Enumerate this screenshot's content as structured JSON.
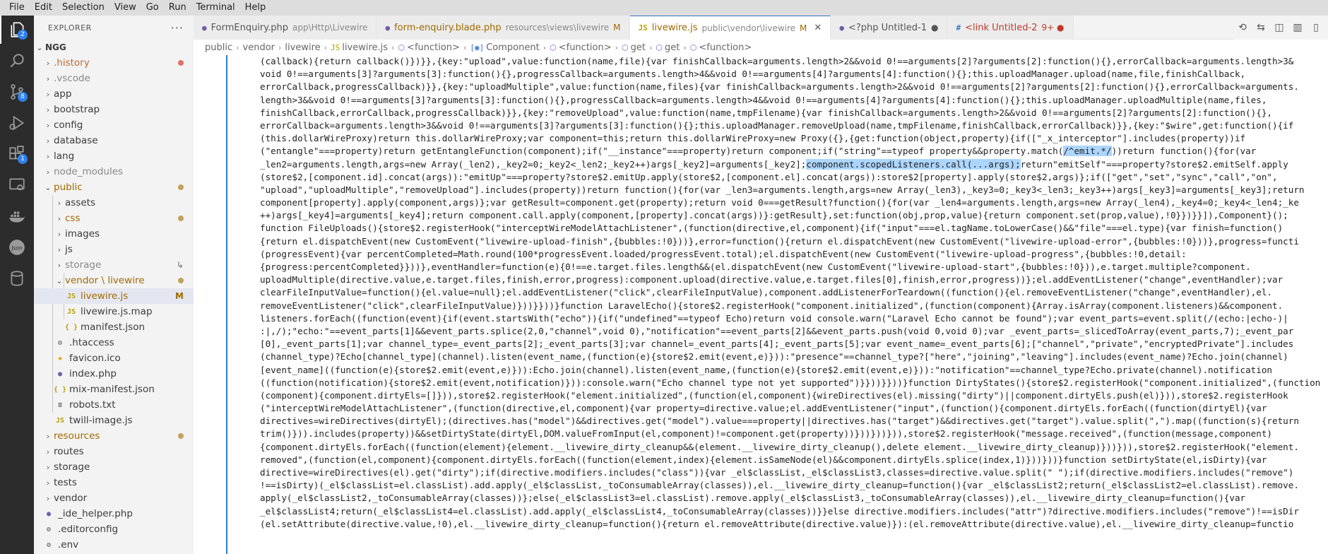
{
  "menu": [
    "File",
    "Edit",
    "Selection",
    "View",
    "Go",
    "Run",
    "Terminal",
    "Help"
  ],
  "activity": {
    "explorer_badge": "2",
    "scm_badge": "8",
    "ext_badge": "1"
  },
  "explorer": {
    "title": "EXPLORER",
    "more": "···",
    "root": "NGG",
    "items": [
      {
        "label": ".history",
        "type": "folder",
        "color": "#c06a30",
        "status": "dot-red"
      },
      {
        "label": ".vscode",
        "type": "folder",
        "color": "#888888",
        "status": ""
      },
      {
        "label": "app",
        "type": "folder",
        "color": "#3a3a3a",
        "status": ""
      },
      {
        "label": "bootstrap",
        "type": "folder",
        "color": "#3a3a3a",
        "status": ""
      },
      {
        "label": "config",
        "type": "folder",
        "color": "#3a3a3a",
        "status": ""
      },
      {
        "label": "database",
        "type": "folder",
        "color": "#3a3a3a",
        "status": ""
      },
      {
        "label": "lang",
        "type": "folder",
        "color": "#3a3a3a",
        "status": ""
      },
      {
        "label": "node_modules",
        "type": "folder",
        "color": "#888888",
        "status": ""
      },
      {
        "label": "public",
        "type": "folder-open",
        "color": "#a06a00",
        "status": "dot-olive"
      },
      {
        "label": "assets",
        "type": "folder",
        "color": "#3a3a3a",
        "status": ""
      },
      {
        "label": "css",
        "type": "folder",
        "color": "#a06a00",
        "status": "dot-olive"
      },
      {
        "label": "images",
        "type": "folder",
        "color": "#3a3a3a",
        "status": ""
      },
      {
        "label": "js",
        "type": "folder",
        "color": "#3a3a3a",
        "status": ""
      },
      {
        "label": "storage",
        "type": "folder",
        "color": "#888888",
        "status": "link"
      },
      {
        "label": "vendor \\ livewire",
        "type": "folder-open",
        "color": "#a06a00",
        "status": "dot-olive"
      },
      {
        "label": "livewire.js",
        "type": "js",
        "color": "#a06a00",
        "status": "M"
      },
      {
        "label": "livewire.js.map",
        "type": "js",
        "color": "#3a3a3a",
        "status": ""
      },
      {
        "label": "manifest.json",
        "type": "json",
        "color": "#3a3a3a",
        "status": ""
      },
      {
        "label": ".htaccess",
        "type": "gear",
        "color": "#3a3a3a",
        "status": ""
      },
      {
        "label": "favicon.ico",
        "type": "star",
        "color": "#3a3a3a",
        "status": ""
      },
      {
        "label": "index.php",
        "type": "php",
        "color": "#3a3a3a",
        "status": ""
      },
      {
        "label": "mix-manifest.json",
        "type": "json",
        "color": "#3a3a3a",
        "status": ""
      },
      {
        "label": "robots.txt",
        "type": "txt",
        "color": "#3a3a3a",
        "status": ""
      },
      {
        "label": "twill-image.js",
        "type": "js",
        "color": "#3a3a3a",
        "status": ""
      },
      {
        "label": "resources",
        "type": "folder",
        "color": "#a06a00",
        "status": "dot-olive"
      },
      {
        "label": "routes",
        "type": "folder",
        "color": "#3a3a3a",
        "status": ""
      },
      {
        "label": "storage",
        "type": "folder",
        "color": "#3a3a3a",
        "status": ""
      },
      {
        "label": "tests",
        "type": "folder",
        "color": "#3a3a3a",
        "status": ""
      },
      {
        "label": "vendor",
        "type": "folder",
        "color": "#3a3a3a",
        "status": ""
      },
      {
        "label": "_ide_helper.php",
        "type": "php",
        "color": "#3a3a3a",
        "status": ""
      },
      {
        "label": ".editorconfig",
        "type": "gear",
        "color": "#3a3a3a",
        "status": ""
      },
      {
        "label": ".env",
        "type": "gear",
        "color": "#3a3a3a",
        "status": ""
      }
    ]
  },
  "tabs": [
    {
      "icon": "php",
      "label": "FormEnquiry.php",
      "desc": "app\\Http\\Livewire",
      "mark": "",
      "active": false,
      "color": "#555555"
    },
    {
      "icon": "php",
      "label": "form-enquiry.blade.php",
      "desc": "resources\\views\\livewire",
      "mark": "M",
      "active": false,
      "color": "#a06a00"
    },
    {
      "icon": "js",
      "label": "livewire.js",
      "desc": "public\\vendor\\livewire",
      "mark": "M",
      "active": true,
      "color": "#a06a00"
    },
    {
      "icon": "php",
      "label": "<?php Untitled-1",
      "desc": "",
      "mark": "●",
      "active": false,
      "color": "#555555"
    },
    {
      "icon": "hash",
      "label": "<link Untitled-2",
      "desc": "",
      "mark": "9+ ●",
      "active": false,
      "color": "#c03a2b"
    }
  ],
  "breadcrumb": [
    "public",
    "vendor",
    "livewire",
    "livewire.js",
    "<function>",
    "Component",
    "<function>",
    "get",
    "get",
    "<function>"
  ],
  "code_lines": [
    "(callback){return callback()})}},{key:\"upload\",value:function(name,file){var finishCallback=arguments.length>2&&void 0!==arguments[2]?arguments[2]:function(){},errorCallback=arguments.length>3&",
    "void 0!==arguments[3]?arguments[3]:function(){},progressCallback=arguments.length>4&&void 0!==arguments[4]?arguments[4]:function(){};this.uploadManager.upload(name,file,finishCallback,",
    "errorCallback,progressCallback)}},{key:\"uploadMultiple\",value:function(name,files){var finishCallback=arguments.length>2&&void 0!==arguments[2]?arguments[2]:function(){},errorCallback=arguments.",
    "length>3&&void 0!==arguments[3]?arguments[3]:function(){},progressCallback=arguments.length>4&&void 0!==arguments[4]?arguments[4]:function(){};this.uploadManager.uploadMultiple(name,files,",
    "finishCallback,errorCallback,progressCallback)}},{key:\"removeUpload\",value:function(name,tmpFilename){var finishCallback=arguments.length>2&&void 0!==arguments[2]?arguments[2]:function(){},",
    "errorCallback=arguments.length>3&&void 0!==arguments[3]?arguments[3]:function(){};this.uploadManager.removeUpload(name,tmpFilename,finishCallback,errorCallback)}},{key:\"$wire\",get:function(){if",
    "(this.dollarWireProxy)return this.dollarWireProxy;var component=this;return this.dollarWireProxy=new Proxy({},{get:function(object,property){if([\"_x_interceptor\"].includes(property))if",
    "(\"entangle\"===property)return getEntangleFunction(component);if(\"__instance\"===property)return component;if(\"string\"==typeof property&&property.match(/^emit.*/))return function(){for(var",
    "_len2=arguments.length,args=new Array(_len2),_key2=0;_key2<_len2;_key2++)args[_key2]=arguments[_key2];component.scopedListeners.call(...args);return\"emitSelf\"===property?store$2.emitSelf.apply",
    "(store$2,[component.id].concat(args)):\"emitUp\"===property?store$2.emitUp.apply(store$2,[component.el].concat(args)):store$2[property].apply(store$2,args)};if([\"get\",\"set\",\"sync\",\"call\",\"on\",",
    "\"upload\",\"uploadMultiple\",\"removeUpload\"].includes(property))return function(){for(var _len3=arguments.length,args=new Array(_len3),_key3=0;_key3<_len3;_key3++)args[_key3]=arguments[_key3];return",
    "component[property].apply(component,args)};var getResult=component.get(property);return void 0===getResult?function(){for(var _len4=arguments.length,args=new Array(_len4),_key4=0;_key4<_len4;_ke",
    "++)args[_key4]=arguments[_key4];return component.call.apply(component,[property].concat(args))}:getResult},set:function(obj,prop,value){return component.set(prop,value),!0}})}}]),Component}();",
    "function FileUploads(){store$2.registerHook(\"interceptWireModelAttachListener\",(function(directive,el,component){if(\"input\"===el.tagName.toLowerCase()&&\"file\"===el.type){var finish=function()",
    "{return el.dispatchEvent(new CustomEvent(\"livewire-upload-finish\",{bubbles:!0}))},error=function(){return el.dispatchEvent(new CustomEvent(\"livewire-upload-error\",{bubbles:!0}))},progress=functi",
    "(progressEvent){var percentCompleted=Math.round(100*progressEvent.loaded/progressEvent.total);el.dispatchEvent(new CustomEvent(\"livewire-upload-progress\",{bubbles:!0,detail:",
    "{progress:percentCompleted}}))},eventHandler=function(e){0!==e.target.files.length&&(el.dispatchEvent(new CustomEvent(\"livewire-upload-start\",{bubbles:!0})),e.target.multiple?component.",
    "uploadMultiple(directive.value,e.target.files,finish,error,progress):component.upload(directive.value,e.target.files[0],finish,error,progress))};el.addEventListener(\"change\",eventHandler);var",
    "clearFileInputValue=function(){el.value=null};el.addEventListener(\"click\",clearFileInputValue),component.addListenerForTeardown((function(){el.removeEventListener(\"change\",eventHandler),el.",
    "removeEventListener(\"click\",clearFileInputValue)}))}}))}function LaravelEcho(){store$2.registerHook(\"component.initialized\",(function(component){Array.isArray(component.listeners)&&component.",
    "listeners.forEach((function(event){if(event.startsWith(\"echo\")){if(\"undefined\"==typeof Echo)return void console.warn(\"Laravel Echo cannot be found\");var event_parts=event.split(/(echo:|echo-)|",
    ":|,/);\"echo:\"==event_parts[1]&&event_parts.splice(2,0,\"channel\",void 0),\"notification\"==event_parts[2]&&event_parts.push(void 0,void 0);var _event_parts=_slicedToArray(event_parts,7);_event_par",
    "[0],_event_parts[1];var channel_type=_event_parts[2];_event_parts[3];var channel=_event_parts[4];_event_parts[5];var event_name=_event_parts[6];[\"channel\",\"private\",\"encryptedPrivate\"].includes",
    "(channel_type)?Echo[channel_type](channel).listen(event_name,(function(e){store$2.emit(event,e)})):\"presence\"==channel_type?[\"here\",\"joining\",\"leaving\"].includes(event_name)?Echo.join(channel)",
    "[event_name]((function(e){store$2.emit(event,e)})):Echo.join(channel).listen(event_name,(function(e){store$2.emit(event,e)})):\"notification\"==channel_type?Echo.private(channel).notification",
    "((function(notification){store$2.emit(event,notification)})):console.warn(\"Echo channel type not yet supported\")}}))}}))}function DirtyStates(){store$2.registerHook(\"component.initialized\",(function",
    "(component){component.dirtyEls=[]})),store$2.registerHook(\"element.initialized\",(function(el,component){wireDirectives(el).missing(\"dirty\")||component.dirtyEls.push(el)})),store$2.registerHook",
    "(\"interceptWireModelAttachListener\",(function(directive,el,component){var property=directive.value;el.addEventListener(\"input\",(function(){component.dirtyEls.forEach((function(dirtyEl){var",
    "directives=wireDirectives(dirtyEl);(directives.has(\"model\")&&directives.get(\"model\").value===property||directives.has(\"target\")&&directives.get(\"target\").value.split(\",\").map((function(s){return",
    "trim()})).includes(property))&&setDirtyState(dirtyEl,DOM.valueFromInput(el,component)!=component.get(property))}))}))})),store$2.registerHook(\"message.received\",(function(message,component)",
    "{component.dirtyEls.forEach((function(element){element.__livewire_dirty_cleanup&&(element.__livewire_dirty_cleanup(),delete element.__livewire_dirty_cleanup)}))})),store$2.registerHook(\"element.",
    "removed\",(function(el,component){component.dirtyEls.forEach((function(element,index){element.isSameNode(el)&&component.dirtyEls.splice(index,1)}))}))}function setDirtyState(el,isDirty){var",
    "directive=wireDirectives(el).get(\"dirty\");if(directive.modifiers.includes(\"class\")){var _el$classList,_el$classList3,classes=directive.value.split(\" \");if(directive.modifiers.includes(\"remove\")",
    "!==isDirty)(_el$classList=el.classList).add.apply(_el$classList,_toConsumableArray(classes)),el.__livewire_dirty_cleanup=function(){var _el$classList2;return(_el$classList2=el.classList).remove.",
    "apply(_el$classList2,_toConsumableArray(classes))};else(_el$classList3=el.classList).remove.apply(_el$classList3,_toConsumableArray(classes)),el.__livewire_dirty_cleanup=function(){var",
    "_el$classList4;return(_el$classList4=el.classList).add.apply(_el$classList4,_toConsumableArray(classes))}}else directive.modifiers.includes(\"attr\")?directive.modifiers.includes(\"remove\")!==isDir",
    "(el.setAttribute(directive.value,!0),el.__livewire_dirty_cleanup=function(){return el.removeAttribute(directive.value)}):(el.removeAttribute(directive.value),el.__livewire_dirty_cleanup=functio"
  ],
  "highlights": [
    {
      "line": 7,
      "text": "/^emit.*/"
    },
    {
      "line": 8,
      "text": "component.scopedListeners.call(...args);"
    }
  ]
}
